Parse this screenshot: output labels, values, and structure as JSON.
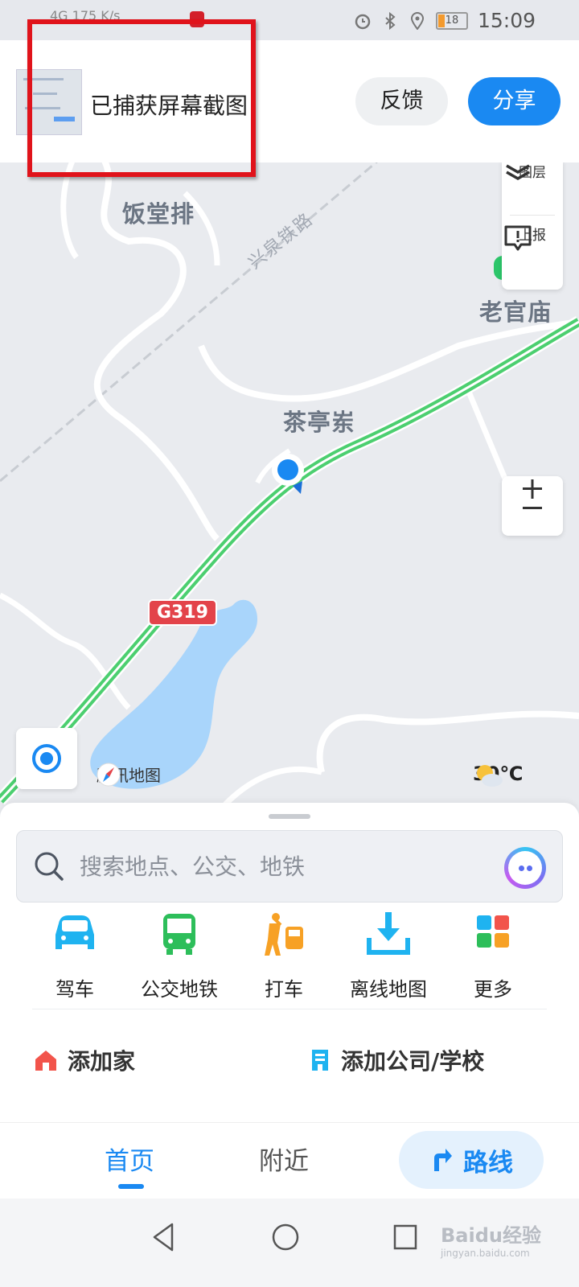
{
  "status_bar": {
    "left_text": "4G  175 K/s",
    "time": "15:09",
    "battery": "18"
  },
  "banner": {
    "text": "已捕获屏幕截图",
    "feedback_label": "反馈",
    "share_label": "分享"
  },
  "map": {
    "places": [
      "饭堂排",
      "老官庙",
      "茶亭岽"
    ],
    "railway": "兴泉铁路",
    "road_shield": "G319",
    "brand": "腾讯地图",
    "temperature": "30℃",
    "layer_label": "图层",
    "report_label": "上报",
    "zoom_text": "±"
  },
  "search": {
    "placeholder": "搜索地点、公交、地铁"
  },
  "quick_actions": [
    {
      "label": "驾车",
      "icon": "car-icon",
      "color": "#1fb3f0"
    },
    {
      "label": "公交地铁",
      "icon": "bus-icon",
      "color": "#2dbe5a"
    },
    {
      "label": "打车",
      "icon": "taxi-icon",
      "color": "#f7a125"
    },
    {
      "label": "离线地图",
      "icon": "download-icon",
      "color": "#1fb3f0"
    },
    {
      "label": "更多",
      "icon": "grid-icon",
      "color": "#1fb3f0"
    }
  ],
  "shortcuts": {
    "home": "添加家",
    "work": "添加公司/学校"
  },
  "tabs": {
    "home": "首页",
    "nearby": "附近",
    "route": "路线"
  },
  "watermark": {
    "brand": "Baidu经验",
    "url": "jingyan.baidu.com"
  },
  "colors": {
    "accent": "#1a89f2",
    "road_green": "#4ccf70",
    "water": "#a9d5fb",
    "highlight_box": "#e0131b"
  }
}
